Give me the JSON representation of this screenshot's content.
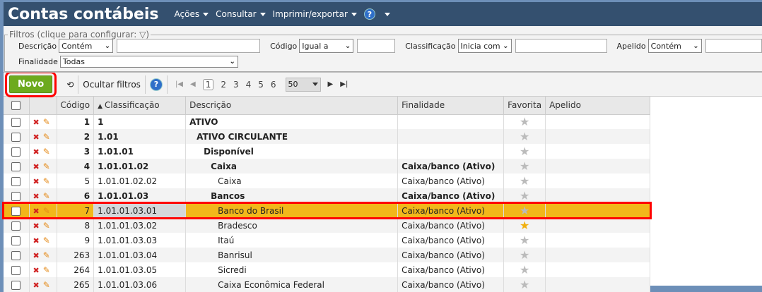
{
  "header": {
    "title": "Contas contábeis",
    "menus": [
      "Ações",
      "Consultar",
      "Imprimir/exportar"
    ],
    "help": "?"
  },
  "filters": {
    "legend": "Filtros (clique para configurar:",
    "legend_end": ")",
    "descricao": {
      "label": "Descrição",
      "op": "Contém",
      "value": ""
    },
    "codigo": {
      "label": "Código",
      "op": "Igual a",
      "value": ""
    },
    "classificacao": {
      "label": "Classificação",
      "op": "Inicia com",
      "value": ""
    },
    "apelido": {
      "label": "Apelido",
      "op": "Contém",
      "value": ""
    },
    "finalidade": {
      "label": "Finalidade",
      "value": "Todas"
    }
  },
  "toolbar": {
    "novo": "Novo",
    "ocultar": "Ocultar filtros",
    "help": "?",
    "pages": [
      "1",
      "2",
      "3",
      "4",
      "5",
      "6"
    ],
    "page_size": "50"
  },
  "columns": [
    "Código",
    "Classificação",
    "Descrição",
    "Finalidade",
    "Favorita",
    "Apelido"
  ],
  "rows": [
    {
      "codigo": "1",
      "classificacao": "1",
      "descricao": "ATIVO",
      "finalidade": "",
      "level": 0,
      "bold": true,
      "fav": false
    },
    {
      "codigo": "2",
      "classificacao": "1.01",
      "descricao": "ATIVO CIRCULANTE",
      "finalidade": "",
      "level": 1,
      "bold": true,
      "fav": false
    },
    {
      "codigo": "3",
      "classificacao": "1.01.01",
      "descricao": "Disponível",
      "finalidade": "",
      "level": 2,
      "bold": true,
      "fav": false
    },
    {
      "codigo": "4",
      "classificacao": "1.01.01.02",
      "descricao": "Caixa",
      "finalidade": "Caixa/banco (Ativo)",
      "level": 3,
      "bold": true,
      "fav": false
    },
    {
      "codigo": "5",
      "classificacao": "1.01.01.02.02",
      "descricao": "Caixa",
      "finalidade": "Caixa/banco (Ativo)",
      "level": 4,
      "bold": false,
      "fav": false
    },
    {
      "codigo": "6",
      "classificacao": "1.01.01.03",
      "descricao": "Bancos",
      "finalidade": "Caixa/banco (Ativo)",
      "level": 3,
      "bold": true,
      "fav": false
    },
    {
      "codigo": "7",
      "classificacao": "1.01.01.03.01",
      "descricao": "Banco do Brasil",
      "finalidade": "Caixa/banco (Ativo)",
      "level": 4,
      "bold": false,
      "fav": false,
      "selected": true
    },
    {
      "codigo": "8",
      "classificacao": "1.01.01.03.02",
      "descricao": "Bradesco",
      "finalidade": "Caixa/banco (Ativo)",
      "level": 4,
      "bold": false,
      "fav": true
    },
    {
      "codigo": "9",
      "classificacao": "1.01.01.03.03",
      "descricao": "Itaú",
      "finalidade": "Caixa/banco (Ativo)",
      "level": 4,
      "bold": false,
      "fav": false
    },
    {
      "codigo": "263",
      "classificacao": "1.01.01.03.04",
      "descricao": "Banrisul",
      "finalidade": "Caixa/banco (Ativo)",
      "level": 4,
      "bold": false,
      "fav": false
    },
    {
      "codigo": "264",
      "classificacao": "1.01.01.03.05",
      "descricao": "Sicredi",
      "finalidade": "Caixa/banco (Ativo)",
      "level": 4,
      "bold": false,
      "fav": false
    },
    {
      "codigo": "265",
      "classificacao": "1.01.01.03.06",
      "descricao": "Caixa Econômica Federal",
      "finalidade": "Caixa/banco (Ativo)",
      "level": 4,
      "bold": false,
      "fav": false
    }
  ]
}
